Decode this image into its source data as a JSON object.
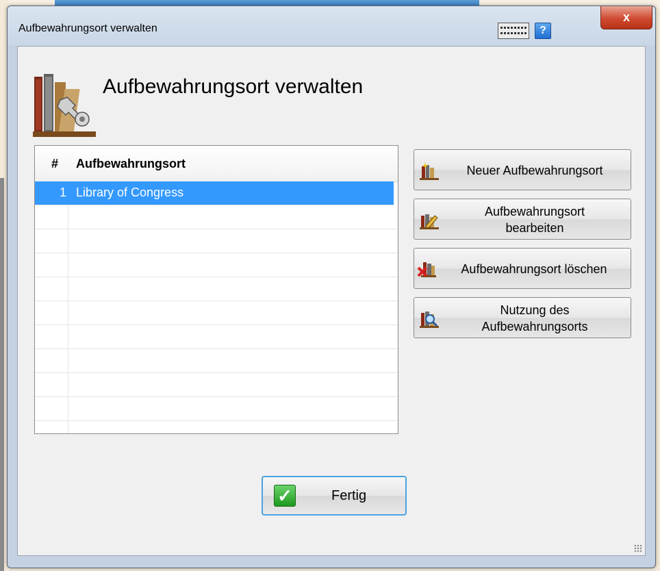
{
  "window": {
    "title": "Aufbewahrungsort verwalten",
    "close_label": "x",
    "help_label": "?"
  },
  "header": {
    "title": "Aufbewahrungsort verwalten"
  },
  "list": {
    "columns": [
      "#",
      "Aufbewahrungsort"
    ],
    "rows": [
      {
        "num": "1",
        "name": "Library of Congress",
        "selected": true
      }
    ]
  },
  "actions": {
    "new_label": "Neuer Aufbewahrungsort",
    "edit_label_line1": "Aufbewahrungsort",
    "edit_label_line2": "bearbeiten",
    "delete_label": "Aufbewahrungsort löschen",
    "usage_label_line1": "Nutzung des",
    "usage_label_line2": "Aufbewahrungsorts"
  },
  "footer": {
    "done_label": "Fertig"
  },
  "colors": {
    "selection": "#3399ff",
    "close": "#cf4a31",
    "accent": "#4aa3df"
  },
  "icons": {
    "header": "bookshelf-wrench-icon",
    "new": "new-location-icon",
    "edit": "edit-location-icon",
    "delete": "delete-location-icon",
    "usage": "search-location-icon",
    "done": "checkmark-icon"
  }
}
